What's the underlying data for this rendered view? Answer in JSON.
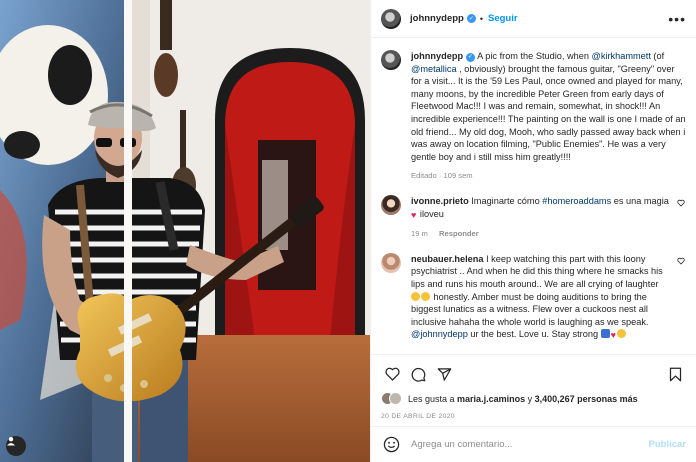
{
  "post": {
    "author": "johnnydepp",
    "follow_label": "Seguir",
    "more_label": "•••",
    "caption": {
      "before_mentions": "A pic from the Studio, when ",
      "mention1": "@kirkhammett",
      "between1": " (of ",
      "mention2": "@metallica",
      "after_mentions": " , obviously) brought the famous guitar, \"Greeny\" over for a visit... It is the '59 Les Paul, once owned and played for many, many moons, by the incredible Peter Green from early days of Fleetwood Mac!!! I was and remain, somewhat, in shock!!! An incredible experience!!! The painting on the wall is one I made of an old friend... My old dog, Mooh, who sadly passed away back when i was away on location filming, \"Public Enemies\". He was a very gentle boy and i still miss him greatly!!!!",
      "meta": "Editado · 109 sem"
    }
  },
  "comments": [
    {
      "user": "ivonne.prieto",
      "text_before": "Imaginarte cómo ",
      "tag": "#homeroaddams",
      "text_after": " es una magia",
      "text_end": " iloveu",
      "time": "19 m",
      "reply": "Responder"
    },
    {
      "user": "neubauer.helena",
      "text": "I keep watching this part with this loony psychiatrist .. And when he did this thing where he smacks his lips and runs his mouth around.. We are all crying of laughter",
      "text2": " honestly. Amber must be doing auditions to bring the biggest lunatics as a witness. Flew over a cuckoos nest all inclusive hahaha the whole world is laughing as we speak.",
      "mention": "@johnnydepp",
      "text3": " ur the best. Love u. Stay strong"
    }
  ],
  "likes": {
    "prefix": "Les gusta a ",
    "user": "maria.j.caminos",
    "middle": " y ",
    "count": "3,400,267 personas más"
  },
  "date": "20 DE ABRIL DE 2020",
  "comment_box": {
    "placeholder": "Agrega un comentario...",
    "publish_label": "Publicar"
  },
  "icons": [
    "verified-icon",
    "heart-icon",
    "comment-icon",
    "share-icon",
    "save-icon",
    "emoji-icon",
    "user-tag-icon"
  ],
  "colors": {
    "link": "#00376b",
    "follow": "#0095f6",
    "verified": "#3897f0",
    "publish_disabled": "#b2dffc"
  }
}
